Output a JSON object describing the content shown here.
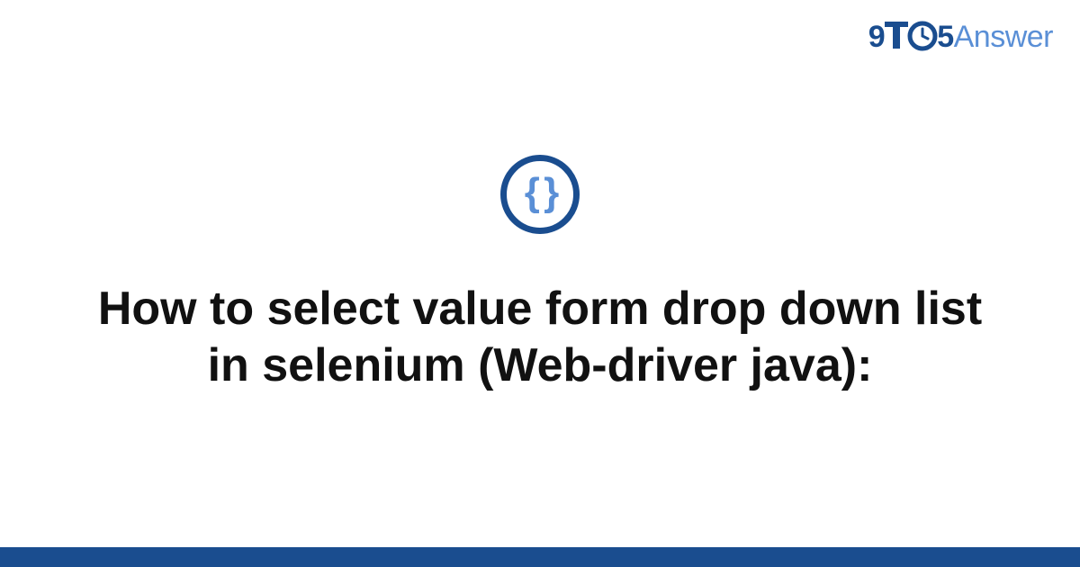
{
  "brand": {
    "nine": "9",
    "five": "5",
    "answer": "Answer"
  },
  "badge": {
    "glyph": "{ }",
    "icon_name": "curly-braces-icon"
  },
  "article": {
    "title": "How to select value form drop down list in selenium (Web-driver java):"
  },
  "colors": {
    "primary_dark": "#1a4d8f",
    "primary_light": "#5a8fd6",
    "text": "#111111",
    "background": "#ffffff"
  }
}
